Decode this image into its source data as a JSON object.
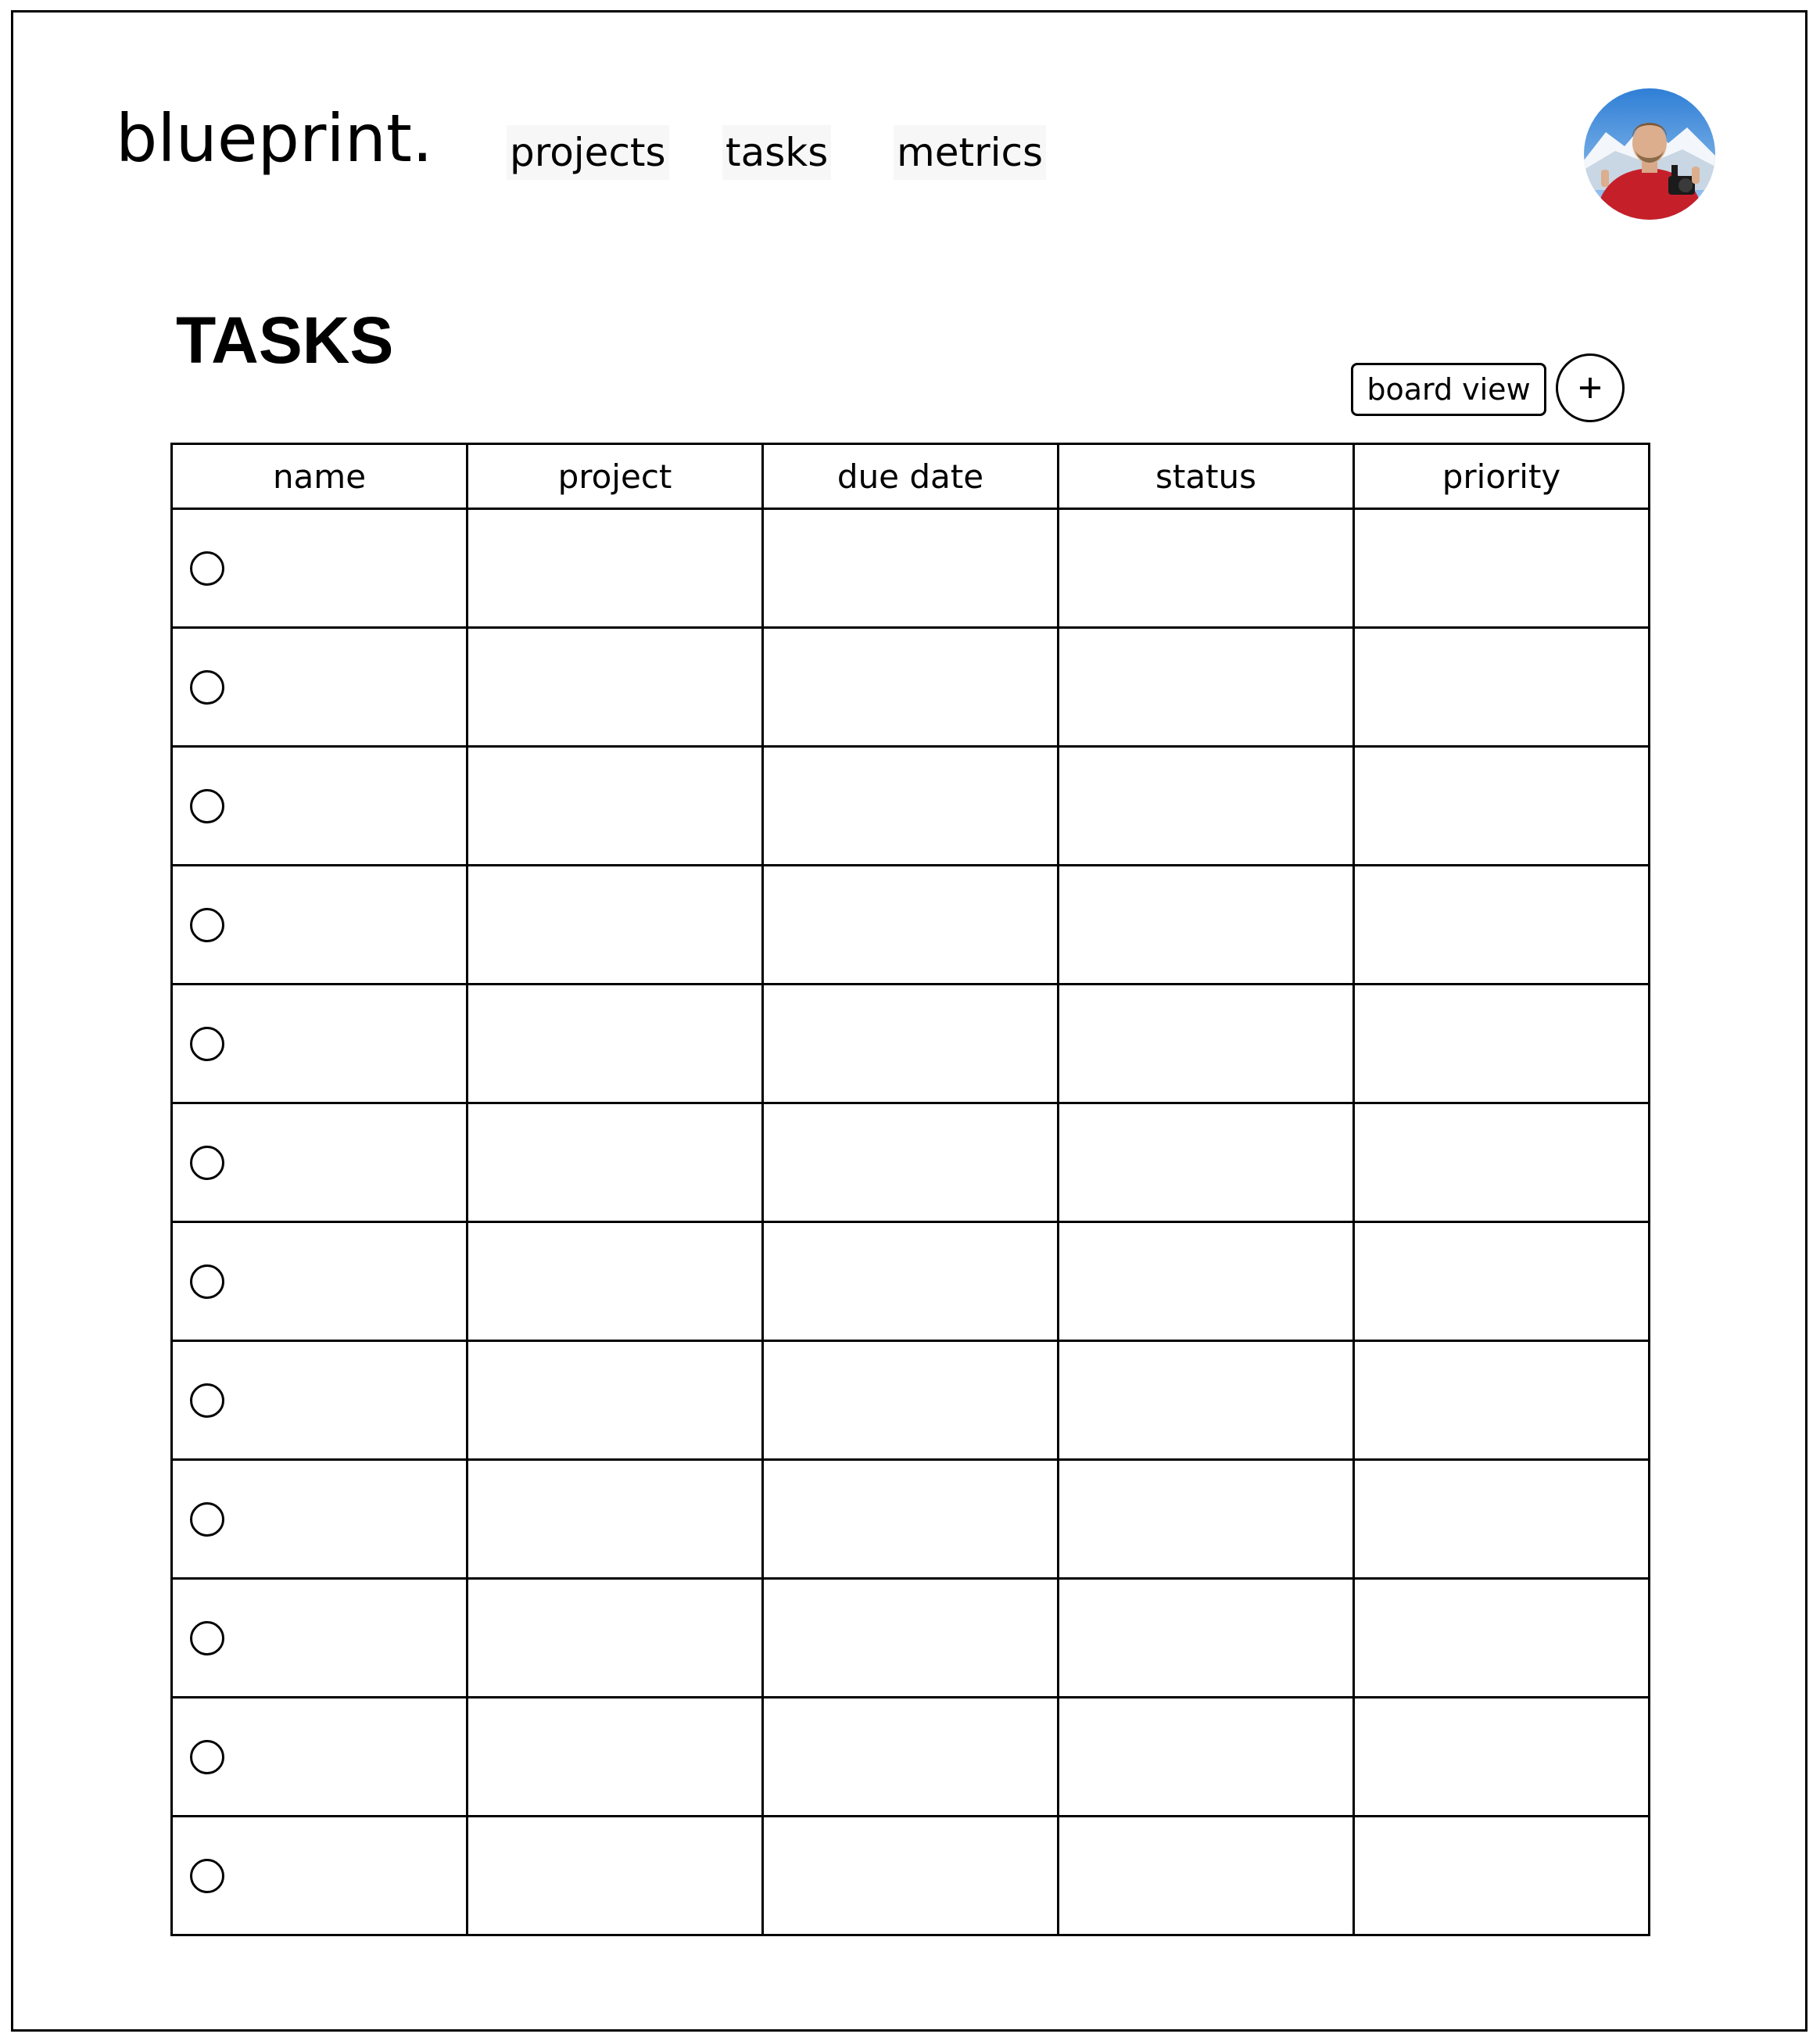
{
  "header": {
    "logo": "blueprint.",
    "nav": [
      {
        "label": "projects"
      },
      {
        "label": "tasks"
      },
      {
        "label": "metrics"
      }
    ]
  },
  "page": {
    "title": "TASKS",
    "board_view_label": "board view",
    "add_icon": "plus-icon"
  },
  "table": {
    "columns": [
      "name",
      "project",
      "due date",
      "status",
      "priority"
    ],
    "row_count": 12
  },
  "colors": {
    "ink": "#000000",
    "background": "#ffffff"
  }
}
